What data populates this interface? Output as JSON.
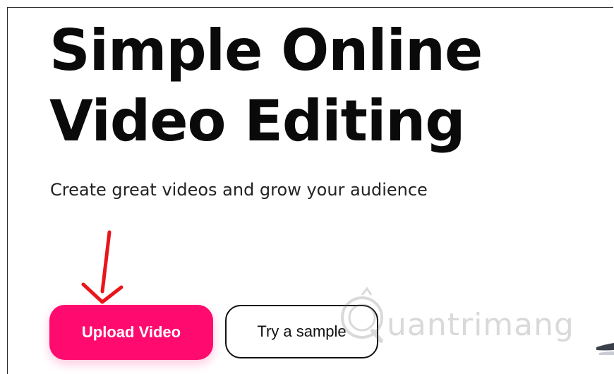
{
  "hero": {
    "title_line1": "Simple Online",
    "title_line2": "Video Editing",
    "subtitle": "Create great videos and grow your audience"
  },
  "actions": {
    "upload_label": "Upload Video",
    "sample_label": "Try a sample"
  },
  "watermark": {
    "text": "uantrimang"
  },
  "colors": {
    "accent": "#ff0a6e",
    "arrow": "#e8151b",
    "text": "#0a0a0a"
  }
}
